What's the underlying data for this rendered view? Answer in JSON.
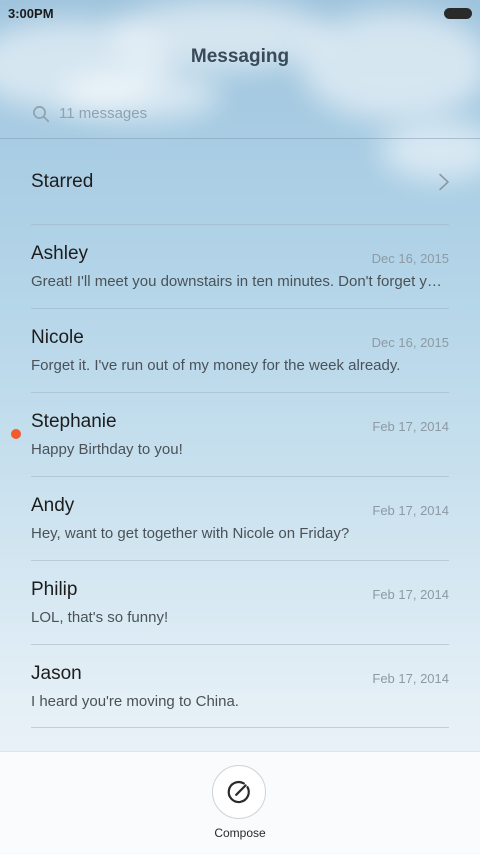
{
  "status_bar": {
    "time": "3:00PM"
  },
  "header": {
    "title": "Messaging"
  },
  "search": {
    "placeholder": "11 messages"
  },
  "starred": {
    "label": "Starred"
  },
  "conversations": [
    {
      "name": "Ashley",
      "date": "Dec 16, 2015",
      "preview": "Great! I'll meet you downstairs in ten minutes. Don't forget your umbrella.",
      "unread": false
    },
    {
      "name": "Nicole",
      "date": "Dec 16, 2015",
      "preview": "Forget it. I've run out of my money for the week already.",
      "unread": false
    },
    {
      "name": "Stephanie",
      "date": "Feb 17, 2014",
      "preview": "Happy Birthday to you!",
      "unread": true
    },
    {
      "name": "Andy",
      "date": "Feb 17, 2014",
      "preview": "Hey, want to get together with Nicole on Friday?",
      "unread": false
    },
    {
      "name": "Philip",
      "date": "Feb 17, 2014",
      "preview": "LOL, that's so funny!",
      "unread": false
    },
    {
      "name": "Jason",
      "date": "Feb 17, 2014",
      "preview": "I heard you're moving to China.",
      "unread": false
    }
  ],
  "bottom_bar": {
    "compose_label": "Compose"
  },
  "colors": {
    "unread_dot": "#f2592b",
    "title": "#3a4a56"
  },
  "icons": {
    "search": "search-icon",
    "chevron": "chevron-right-icon",
    "compose": "compose-icon",
    "battery": "battery-icon"
  }
}
